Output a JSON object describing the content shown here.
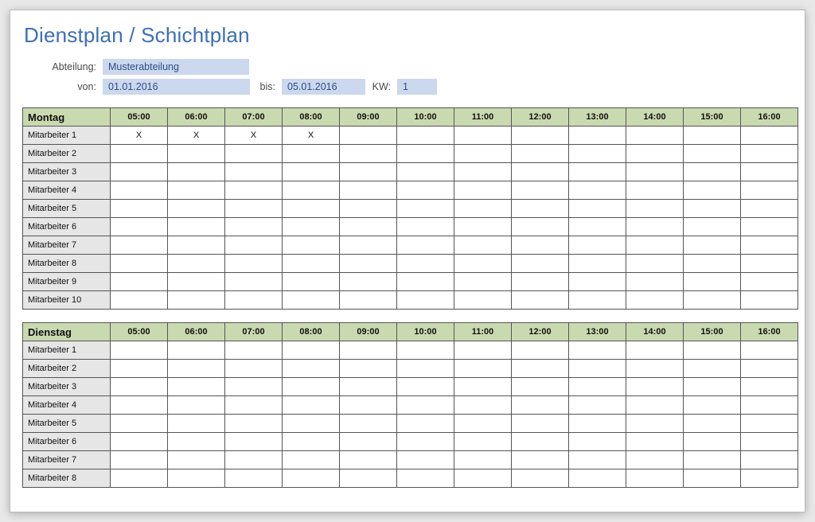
{
  "title": "Dienstplan / Schichtplan",
  "meta": {
    "dept_label": "Abteilung:",
    "dept_value": "Musterabteilung",
    "from_label": "von:",
    "from_value": "01.01.2016",
    "to_label": "bis:",
    "to_value": "05.01.2016",
    "kw_label": "KW:",
    "kw_value": "1"
  },
  "hours": [
    "05:00",
    "06:00",
    "07:00",
    "08:00",
    "09:00",
    "10:00",
    "11:00",
    "12:00",
    "13:00",
    "14:00",
    "15:00",
    "16:00"
  ],
  "days": [
    {
      "name": "Montag",
      "rows": [
        {
          "emp": "Mitarbeiter 1",
          "cells": [
            "X",
            "X",
            "X",
            "X",
            "",
            "",
            "",
            "",
            "",
            "",
            "",
            ""
          ]
        },
        {
          "emp": "Mitarbeiter 2",
          "cells": [
            "",
            "",
            "",
            "",
            "",
            "",
            "",
            "",
            "",
            "",
            "",
            ""
          ]
        },
        {
          "emp": "Mitarbeiter 3",
          "cells": [
            "",
            "",
            "",
            "",
            "",
            "",
            "",
            "",
            "",
            "",
            "",
            ""
          ]
        },
        {
          "emp": "Mitarbeiter 4",
          "cells": [
            "",
            "",
            "",
            "",
            "",
            "",
            "",
            "",
            "",
            "",
            "",
            ""
          ]
        },
        {
          "emp": "Mitarbeiter 5",
          "cells": [
            "",
            "",
            "",
            "",
            "",
            "",
            "",
            "",
            "",
            "",
            "",
            ""
          ]
        },
        {
          "emp": "Mitarbeiter 6",
          "cells": [
            "",
            "",
            "",
            "",
            "",
            "",
            "",
            "",
            "",
            "",
            "",
            ""
          ]
        },
        {
          "emp": "Mitarbeiter 7",
          "cells": [
            "",
            "",
            "",
            "",
            "",
            "",
            "",
            "",
            "",
            "",
            "",
            ""
          ]
        },
        {
          "emp": "Mitarbeiter 8",
          "cells": [
            "",
            "",
            "",
            "",
            "",
            "",
            "",
            "",
            "",
            "",
            "",
            ""
          ]
        },
        {
          "emp": "Mitarbeiter 9",
          "cells": [
            "",
            "",
            "",
            "",
            "",
            "",
            "",
            "",
            "",
            "",
            "",
            ""
          ]
        },
        {
          "emp": "Mitarbeiter 10",
          "cells": [
            "",
            "",
            "",
            "",
            "",
            "",
            "",
            "",
            "",
            "",
            "",
            ""
          ]
        }
      ]
    },
    {
      "name": "Dienstag",
      "rows": [
        {
          "emp": "Mitarbeiter 1",
          "cells": [
            "",
            "",
            "",
            "",
            "",
            "",
            "",
            "",
            "",
            "",
            "",
            ""
          ]
        },
        {
          "emp": "Mitarbeiter 2",
          "cells": [
            "",
            "",
            "",
            "",
            "",
            "",
            "",
            "",
            "",
            "",
            "",
            ""
          ]
        },
        {
          "emp": "Mitarbeiter 3",
          "cells": [
            "",
            "",
            "",
            "",
            "",
            "",
            "",
            "",
            "",
            "",
            "",
            ""
          ]
        },
        {
          "emp": "Mitarbeiter 4",
          "cells": [
            "",
            "",
            "",
            "",
            "",
            "",
            "",
            "",
            "",
            "",
            "",
            ""
          ]
        },
        {
          "emp": "Mitarbeiter 5",
          "cells": [
            "",
            "",
            "",
            "",
            "",
            "",
            "",
            "",
            "",
            "",
            "",
            ""
          ]
        },
        {
          "emp": "Mitarbeiter 6",
          "cells": [
            "",
            "",
            "",
            "",
            "",
            "",
            "",
            "",
            "",
            "",
            "",
            ""
          ]
        },
        {
          "emp": "Mitarbeiter 7",
          "cells": [
            "",
            "",
            "",
            "",
            "",
            "",
            "",
            "",
            "",
            "",
            "",
            ""
          ]
        },
        {
          "emp": "Mitarbeiter 8",
          "cells": [
            "",
            "",
            "",
            "",
            "",
            "",
            "",
            "",
            "",
            "",
            "",
            ""
          ]
        }
      ]
    }
  ]
}
